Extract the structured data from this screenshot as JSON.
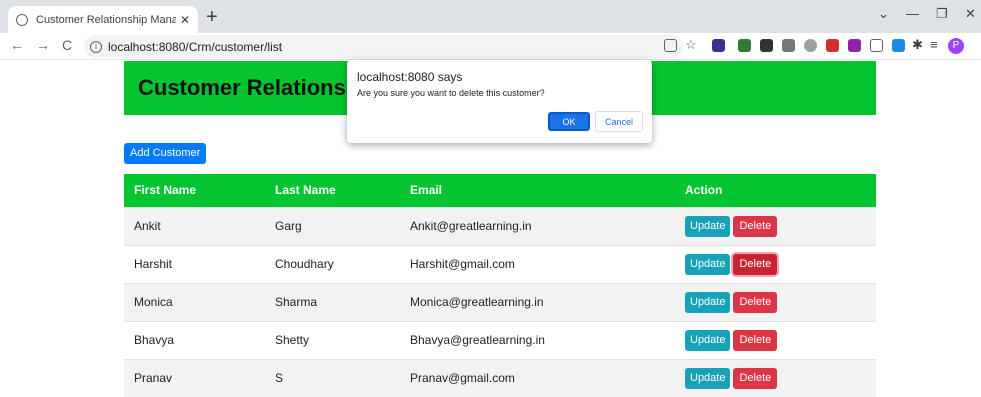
{
  "browser": {
    "tab_title": "Customer Relationship Managemen",
    "tab_close": "✕",
    "new_tab": "+",
    "url": "localhost:8080/Crm/customer/list",
    "nav_back": "←",
    "nav_forward": "→",
    "nav_reload": "C",
    "win_chevron": "⌄",
    "win_minimize": "—",
    "win_maximize": "❐",
    "win_close": "✕",
    "profile_initial": "P"
  },
  "header": {
    "title": "Customer Relationship Management"
  },
  "actions": {
    "add_label": "Add Customer"
  },
  "table": {
    "headers": [
      "First Name",
      "Last Name",
      "Email",
      "Action"
    ],
    "rows": [
      {
        "first": "Ankit",
        "last": "Garg",
        "email": "Ankit@greatlearning.in"
      },
      {
        "first": "Harshit",
        "last": "Choudhary",
        "email": "Harshit@gmail.com"
      },
      {
        "first": "Monica",
        "last": "Sharma",
        "email": "Monica@greatlearning.in"
      },
      {
        "first": "Bhavya",
        "last": "Shetty",
        "email": "Bhavya@greatlearning.in"
      },
      {
        "first": "Pranav",
        "last": "S",
        "email": "Pranav@gmail.com"
      }
    ],
    "update_label": "Update",
    "delete_label": "Delete"
  },
  "dialog": {
    "title": "localhost:8080 says",
    "message": "Are you sure you want to delete this customer?",
    "ok_label": "OK",
    "cancel_label": "Cancel"
  },
  "colors": {
    "header_green": "#04c530",
    "primary": "#007bff",
    "info": "#17a2b8",
    "danger": "#dc3545"
  }
}
